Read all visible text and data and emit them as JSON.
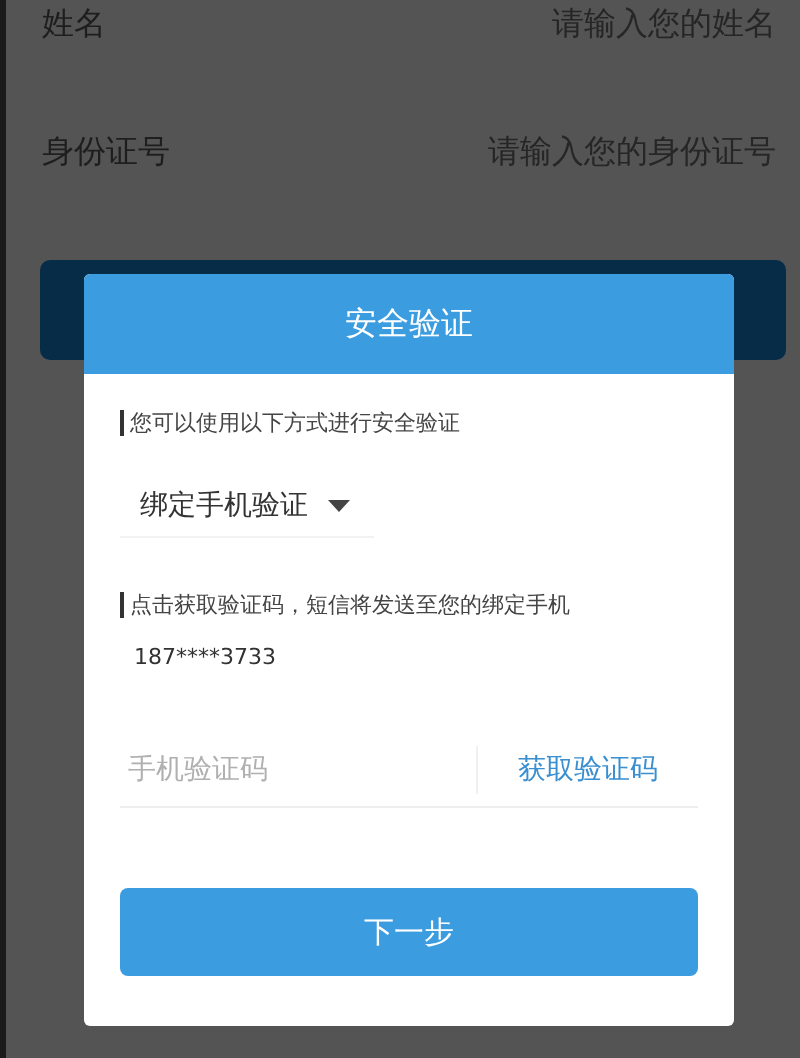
{
  "background_form": {
    "fields": [
      {
        "label": "姓名",
        "placeholder": "请输入您的姓名"
      },
      {
        "label": "身份证号",
        "placeholder": "请输入您的身份证号"
      }
    ]
  },
  "dialog": {
    "title": "安全验证",
    "intro": "您可以使用以下方式进行安全验证",
    "method": {
      "value": "绑定手机验证"
    },
    "notice": "点击获取验证码，短信将发送至您的绑定手机",
    "phone": "187****3733",
    "code_field": {
      "placeholder": "手机验证码"
    },
    "get_code_button": "获取验证码",
    "next_button": "下一步"
  }
}
